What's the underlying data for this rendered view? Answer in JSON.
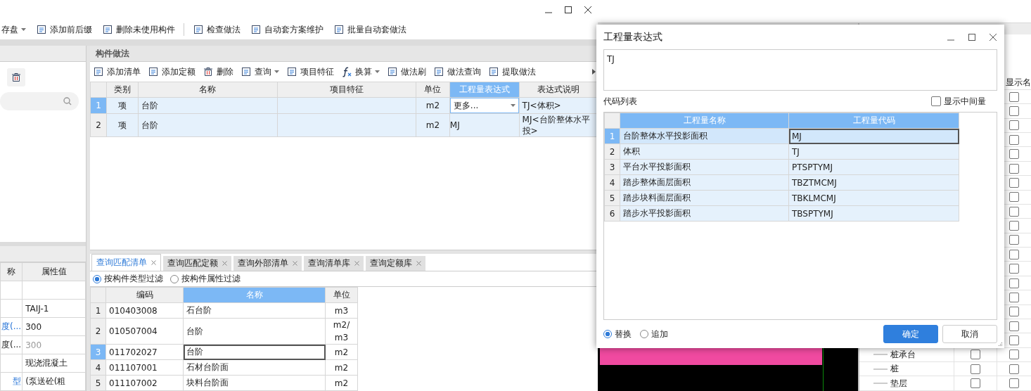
{
  "main_window": {
    "toolbar": [
      {
        "label": "存盘",
        "menu": true
      },
      {
        "label": "添加前后缀",
        "menu": false
      },
      {
        "label": "删除未使用构件",
        "menu": false
      },
      {
        "label": "检查做法",
        "menu": false,
        "separator_before": true
      },
      {
        "label": "自动套方案维护",
        "menu": false
      },
      {
        "label": "批量自动套做法",
        "menu": false
      }
    ]
  },
  "left_pane": {
    "properties": {
      "columns": [
        "称",
        "属性值"
      ],
      "rows": [
        {},
        {
          "value": "TAIJ-1"
        },
        {
          "name": "度(...",
          "value": "300",
          "link": true
        },
        {
          "name": "度(...",
          "value": "300",
          "dimmed": true
        },
        {
          "value": "现浇混凝土"
        },
        {
          "name": "型",
          "value": "(泵送砼(粗",
          "link": true
        }
      ]
    }
  },
  "component_method": {
    "title": "构件做法",
    "toolbar": [
      {
        "label": "添加清单",
        "menu": false
      },
      {
        "label": "添加定额",
        "menu": false
      },
      {
        "label": "删除",
        "menu": false
      },
      {
        "label": "查询",
        "menu": true
      },
      {
        "label": "项目特征",
        "menu": false
      },
      {
        "label": "换算",
        "menu": true
      },
      {
        "label": "做法刷",
        "menu": false
      },
      {
        "label": "做法查询",
        "menu": false
      },
      {
        "label": "提取做法",
        "menu": false
      }
    ],
    "table": {
      "columns": [
        {
          "label": "类别",
          "selected": false
        },
        {
          "label": "名称",
          "selected": false
        },
        {
          "label": "项目特征",
          "selected": false
        },
        {
          "label": "单位",
          "selected": false
        },
        {
          "label": "工程量表达式",
          "selected": true
        },
        {
          "label": "表达式说明",
          "selected": false
        }
      ],
      "rows": [
        {
          "number": "1",
          "type": "项",
          "name": "台阶",
          "unit": "m2",
          "expression": "更多...",
          "dropdown": true,
          "description": "TJ<体积>",
          "selected": true
        },
        {
          "number": "2",
          "type": "项",
          "name": "台阶",
          "unit": "m2",
          "expression": "MJ",
          "dropdown": false,
          "description": "MJ<台阶整体水平投>",
          "selected": false
        }
      ]
    }
  },
  "query": {
    "tabs": [
      {
        "label": "查询匹配清单",
        "selected": true
      },
      {
        "label": "查询匹配定额",
        "selected": false
      },
      {
        "label": "查询外部清单",
        "selected": false
      },
      {
        "label": "查询清单库",
        "selected": false
      },
      {
        "label": "查询定额库",
        "selected": false
      }
    ],
    "filters": [
      {
        "label": "按构件类型过滤",
        "selected": true
      },
      {
        "label": "按构件属性过滤",
        "selected": false
      }
    ],
    "columns": [
      {
        "label": "编码",
        "selected": false
      },
      {
        "label": "名称",
        "selected": true
      },
      {
        "label": "单位",
        "selected": false
      }
    ],
    "rows": [
      {
        "number": "1",
        "code": "010403008",
        "name": "石台阶",
        "unit": "m3",
        "selected": false
      },
      {
        "number": "2",
        "code": "010507004",
        "name": "台阶",
        "unit": "m2/m3",
        "selected": false
      },
      {
        "number": "3",
        "code": "011702027",
        "name": "台阶",
        "unit": "m2",
        "selected": true
      },
      {
        "number": "4",
        "code": "011107001",
        "name": "石材台阶面",
        "unit": "m2",
        "selected": false
      },
      {
        "number": "5",
        "code": "011107002",
        "name": "块料台阶面",
        "unit": "m2",
        "selected": false
      }
    ]
  },
  "layer_panel": {
    "header": "显示名",
    "rows": [
      {
        "check_b": false
      },
      {
        "check_b": false
      },
      {
        "check_b": false
      },
      {
        "check_b": false
      },
      {
        "check_b": false
      },
      {
        "check_b": false
      },
      {
        "check_b": false
      },
      {
        "check_b": false
      },
      {
        "check_b": false
      },
      {
        "check_b": false
      },
      {
        "check_b": false
      },
      {
        "check_b": false
      },
      {
        "check_b": false
      },
      {
        "check_b": false
      },
      {
        "check_b": false
      },
      {
        "check_b": false
      },
      {
        "check_b": false
      },
      {
        "check_b": false
      },
      {
        "label": "桩承台",
        "check_a": false,
        "check_b": false
      },
      {
        "label": "桩",
        "check_a": false,
        "check_b": false
      },
      {
        "label": "垫层",
        "check_a": false,
        "check_b": false
      }
    ]
  },
  "dialog": {
    "title": "工程量表达式",
    "expression": "TJ",
    "code_list_label": "代码列表",
    "show_intermediate": {
      "label": "显示中间量",
      "checked": false
    },
    "columns": [
      "工程量名称",
      "工程量代码"
    ],
    "rows": [
      {
        "number": "1",
        "name": "台阶整体水平投影面积",
        "code": "MJ",
        "selected": true
      },
      {
        "number": "2",
        "name": "体积",
        "code": "TJ",
        "selected": false
      },
      {
        "number": "3",
        "name": "平台水平投影面积",
        "code": "PTSPTYMJ",
        "selected": false
      },
      {
        "number": "4",
        "name": "踏步整体面层面积",
        "code": "TBZTMCMJ",
        "selected": false
      },
      {
        "number": "5",
        "name": "踏步块料面层面积",
        "code": "TBKLMCMJ",
        "selected": false
      },
      {
        "number": "6",
        "name": "踏步水平投影面积",
        "code": "TBSPTYMJ",
        "selected": false
      }
    ],
    "modes": [
      {
        "label": "替换",
        "selected": true
      },
      {
        "label": "追加",
        "selected": false
      }
    ],
    "buttons": [
      {
        "label": "确定",
        "kind": "primary"
      },
      {
        "label": "取消",
        "kind": "secondary"
      }
    ]
  }
}
